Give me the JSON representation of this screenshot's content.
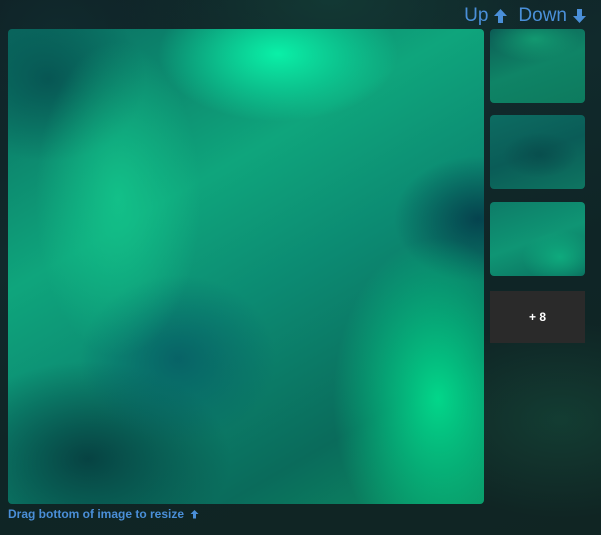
{
  "nav": {
    "up_label": "Up",
    "down_label": "Down"
  },
  "gallery": {
    "main_image": {
      "icon": "aurora-image"
    },
    "thumbnails": [
      {
        "icon": "aurora-thumbnail"
      },
      {
        "icon": "aurora-thumbnail"
      },
      {
        "icon": "aurora-thumbnail"
      }
    ],
    "more_label": "+ 8"
  },
  "resize_hint": {
    "label": "Drag bottom of image to resize"
  },
  "colors": {
    "link": "#4a8fd8",
    "more_tile": "#2a2a2a",
    "background": "#0f1f24"
  }
}
